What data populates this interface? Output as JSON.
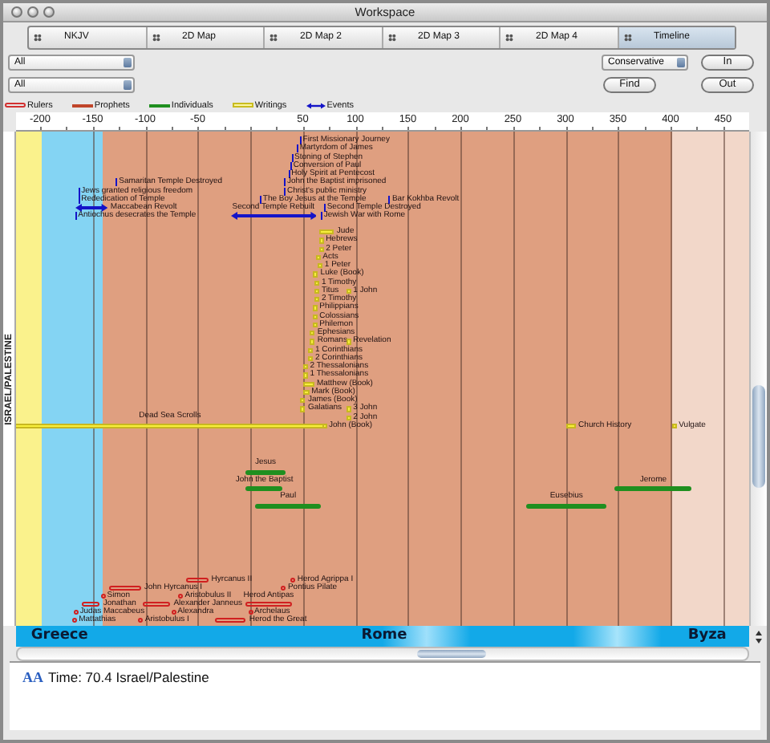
{
  "window": {
    "title": "Workspace"
  },
  "tabs": [
    {
      "label": "NKJV",
      "selected": false
    },
    {
      "label": "2D Map",
      "selected": false
    },
    {
      "label": "2D Map 2",
      "selected": false
    },
    {
      "label": "2D Map 3",
      "selected": false
    },
    {
      "label": "2D Map 4",
      "selected": false
    },
    {
      "label": "Timeline",
      "selected": true
    }
  ],
  "filters": [
    {
      "value": "All"
    },
    {
      "value": "All"
    }
  ],
  "view_select": {
    "value": "Conservative"
  },
  "buttons": {
    "find": "Find",
    "zoom_in": "In",
    "zoom_out": "Out"
  },
  "legend": [
    {
      "label": "Rulers",
      "kind": "ruler"
    },
    {
      "label": "Prophets",
      "kind": "prophet"
    },
    {
      "label": "Individuals",
      "kind": "individual"
    },
    {
      "label": "Writings",
      "kind": "writing"
    },
    {
      "label": "Events",
      "kind": "event"
    }
  ],
  "axis_ticks": [
    "-200",
    "-150",
    "-100",
    "-50",
    "50",
    "100",
    "150",
    "200",
    "250",
    "300",
    "350",
    "400",
    "450"
  ],
  "region_label": "ISRAEL/PALESTINE",
  "bands": [
    {
      "color": "#faf28c"
    },
    {
      "color": "#84d4f3"
    },
    {
      "color": "#df9f80"
    },
    {
      "color": "#f2d7c9"
    }
  ],
  "event_rows": [
    [
      {
        "label": "First Missionary Journey",
        "kind": "point"
      }
    ],
    [
      {
        "label": "Martyrdom of James",
        "kind": "point"
      }
    ],
    [
      {
        "label": "Stoning of Stephen",
        "kind": "point"
      }
    ],
    [
      {
        "label": "Conversion of Paul",
        "kind": "point"
      }
    ],
    [
      {
        "label": "Holy Spirit at Pentecost",
        "kind": "point"
      }
    ],
    [
      {
        "label": "Samaritan Temple Destroyed",
        "kind": "point"
      },
      {
        "label": "John the Baptist imprisoned",
        "kind": "point"
      }
    ],
    [
      {
        "label": "Jews granted religious freedom",
        "kind": "point"
      },
      {
        "label": "Christ's public ministry",
        "kind": "point"
      }
    ],
    [
      {
        "label": "Rededication of Temple",
        "kind": "point"
      },
      {
        "label": "The Boy Jesus at the Temple",
        "kind": "point"
      },
      {
        "label": "Bar Kokhba Revolt",
        "kind": "point"
      }
    ],
    [
      {
        "label": "Maccabean Revolt",
        "kind": "span"
      },
      {
        "label": "Second Temple Destroyed",
        "kind": "point"
      }
    ],
    [
      {
        "label": "Antiochus desecrates the Temple",
        "kind": "point"
      },
      {
        "label": "Second Temple Rebuilt",
        "kind": "span"
      },
      {
        "label": "Jewish War with Rome",
        "kind": "point"
      }
    ]
  ],
  "writing_rows": [
    [
      {
        "label": "Jude"
      }
    ],
    [
      {
        "label": "Hebrews"
      }
    ],
    [
      {
        "label": "2 Peter"
      }
    ],
    [
      {
        "label": "Acts"
      }
    ],
    [
      {
        "label": "1 Peter"
      }
    ],
    [
      {
        "label": "Luke (Book)"
      }
    ],
    [
      {
        "label": "1 Timothy"
      }
    ],
    [
      {
        "label": "Titus"
      },
      {
        "label": "1 John"
      }
    ],
    [
      {
        "label": "2 Timothy"
      }
    ],
    [
      {
        "label": "Philippians"
      }
    ],
    [
      {
        "label": "Colossians"
      }
    ],
    [
      {
        "label": "Philemon"
      }
    ],
    [
      {
        "label": "Ephesians"
      }
    ],
    [
      {
        "label": "Romans"
      },
      {
        "label": "Revelation"
      }
    ],
    [
      {
        "label": "1 Corinthians"
      }
    ],
    [
      {
        "label": "2 Corinthians"
      }
    ],
    [
      {
        "label": "2 Thessalonians"
      }
    ],
    [
      {
        "label": "1 Thessalonians"
      }
    ],
    [
      {
        "label": "Matthew (Book)"
      }
    ],
    [
      {
        "label": "Mark (Book)"
      }
    ],
    [
      {
        "label": "James (Book)"
      }
    ],
    [
      {
        "label": "Galatians"
      },
      {
        "label": "3 John"
      }
    ],
    [
      {
        "label": "2 John"
      }
    ],
    [
      {
        "label": "Dead Sea Scrolls"
      },
      {
        "label": "John (Book)"
      },
      {
        "label": "Church History"
      },
      {
        "label": "Vulgate"
      }
    ]
  ],
  "individual_rows": [
    [
      {
        "label": "Jesus"
      }
    ],
    [
      {
        "label": "John the Baptist"
      },
      {
        "label": "Jerome"
      }
    ],
    [
      {
        "label": "Paul"
      },
      {
        "label": "Eusebius"
      }
    ]
  ],
  "ruler_rows": [
    [
      {
        "label": "Hyrcanus II",
        "kind": "span"
      },
      {
        "label": "Herod Agrippa I",
        "kind": "point"
      }
    ],
    [
      {
        "label": "John Hyrcanus I",
        "kind": "span"
      },
      {
        "label": "Pontius Pilate",
        "kind": "point"
      }
    ],
    [
      {
        "label": "Simon",
        "kind": "point"
      },
      {
        "label": "Aristobulus II",
        "kind": "point"
      }
    ],
    [
      {
        "label": "Jonathan",
        "kind": "span"
      },
      {
        "label": "Alexander Janneus",
        "kind": "span"
      },
      {
        "label": "Herod Antipas",
        "kind": "span"
      }
    ],
    [
      {
        "label": "Judas Maccabeus",
        "kind": "point"
      },
      {
        "label": "Alexandra",
        "kind": "point"
      },
      {
        "label": "Archelaus",
        "kind": "point"
      }
    ],
    [
      {
        "label": "Mattathias",
        "kind": "point"
      },
      {
        "label": "Aristobulus I",
        "kind": "point"
      },
      {
        "label": "Herod the Great",
        "kind": "span"
      }
    ]
  ],
  "eras": [
    {
      "name": "Greece"
    },
    {
      "name": "Rome"
    },
    {
      "name": "Byza"
    }
  ],
  "readout": {
    "font_button": "AA",
    "text": "Time: 70.4 Israel/Palestine"
  }
}
